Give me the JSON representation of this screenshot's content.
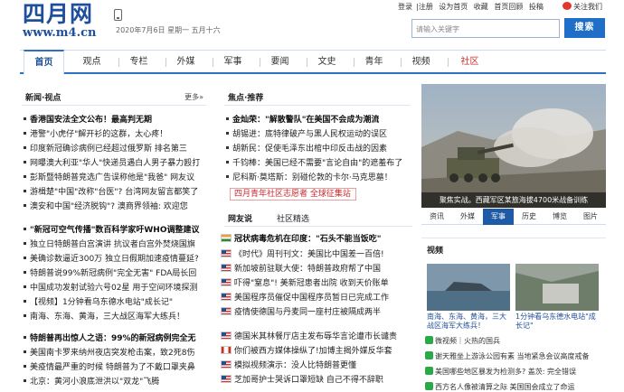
{
  "header": {
    "logo_cn": "四月网",
    "logo_en": "www.m4.cn",
    "date": "2020年7月6日 星期一 五月十六",
    "toplinks": [
      "登录",
      "注册",
      "设为首页",
      "收藏",
      "首页回顾",
      "投稿"
    ],
    "follow": "关注我们",
    "search_placeholder": "请输入关键字",
    "search_button": "搜索"
  },
  "nav": [
    "首页",
    "观点",
    "专栏",
    "外媒",
    "军事",
    "要闻",
    "文史",
    "青年",
    "视频",
    "社区"
  ],
  "col1": {
    "title": "新闻·视点",
    "more": "更多»",
    "items": [
      "香港国安法全文公布！最高判无期",
      "港警\"小虎仔\"解开衫的这群，太心疼！",
      "印度新冠确诊病例已经超过俄罗斯 排名第三",
      "网曝澳大利亚\"华人\"快递员遇白人男子暴力殴打",
      "彭斯暨特朗普竞选广告误称他是\"我爸\" 网友议",
      "游楫楚\"中国\"改称\"台医\"? 台湾网友留言都笑了",
      "澳安和中国\"经济脱钩\"? 澳商界领袖: 欢迎您",
      "\"新冠可空气传播\"数百科学家吁WHO调整建议",
      "独立日特朗普白宫演讲 抗议者白宫外焚烧国旗",
      "美确诊数逼近300万 独立日假期加速疫情蔓延?",
      "特朗普说99%新冠病例\"完全无害\" FDA局长回",
      "中国成功发射试验六号02星 用于空间环境探测",
      "【视频】1分钟看乌东德水电站\"成长记\"",
      "南海、东海、黄海，三大战区海军大练兵！",
      "特朗普再出惊人之语：99%的新冠病例完全无",
      "美国南卡罗来纳州夜店突发枪击案，致2死8伤",
      "美疫情最严重的时候 特朗普为了不戴口罩夹鼻",
      "北京：黄河小浪底泄洪以\"双龙\"飞腾"
    ]
  },
  "col2": {
    "title": "焦点·推荐",
    "items": [
      "金灿荣：\"解散警队\"在美国不会成为潮流",
      "胡锡进：底特律破产与黑人民权运动的误区",
      "胡新民：促使毛泽东出棺中印反击战的因素",
      "千钧棒：美国已经不需要\"言论自由\"的遮羞布了",
      "尼科斯·莫塔斯：别碰伦敦的卡尔·马克思墓！"
    ],
    "red_box": "四月青年社区志愿者 全球征集站",
    "tabs": [
      "网友说",
      "社区精选"
    ],
    "items2": [
      "冠状病毒危机在印度：\"石头不能当饭吃\"",
      "《时代》周刊刊文：美国比中国差一百倍!",
      "新加坡前驻联大使：特朗普政府帮了中国",
      "吓得\"窒息\"! 美新冠患者出院 收到天价账单",
      "美国程序员催促中国程序员暂日已完成工作",
      "疫情使德国与丹麦同一座村庄被隔成两半",
      "德国米其林餐厅店主发布辱华言论遭市长谴责",
      "你们被西方媒体操纵了!加博主揭外媒反华套",
      "模拟视频演示：没人比特朗普更懂",
      "芝加哥护士哭诉口罩短缺 自己不得不辞职"
    ]
  },
  "right": {
    "photo_caption": "聚焦实战。西藏军区某旅海拔4700米战备训练",
    "tabs": [
      "资讯",
      "外媒",
      "军事",
      "历史",
      "博览",
      "图片"
    ],
    "video_title": "视频",
    "videos": [
      "南海、东海、黄海，三大战区海军大练兵！",
      "1分钟看乌东德水电站\"成长记\""
    ],
    "list": [
      "微视频｜火热的国兵",
      "谢天雅坐上游泳公园有素 当地紧急会议高度戒备",
      "美国哪些地区暴发为检测多? 盖茨: 完全错误",
      "西方名人像被清算之际 美国国会成立了命运"
    ]
  }
}
